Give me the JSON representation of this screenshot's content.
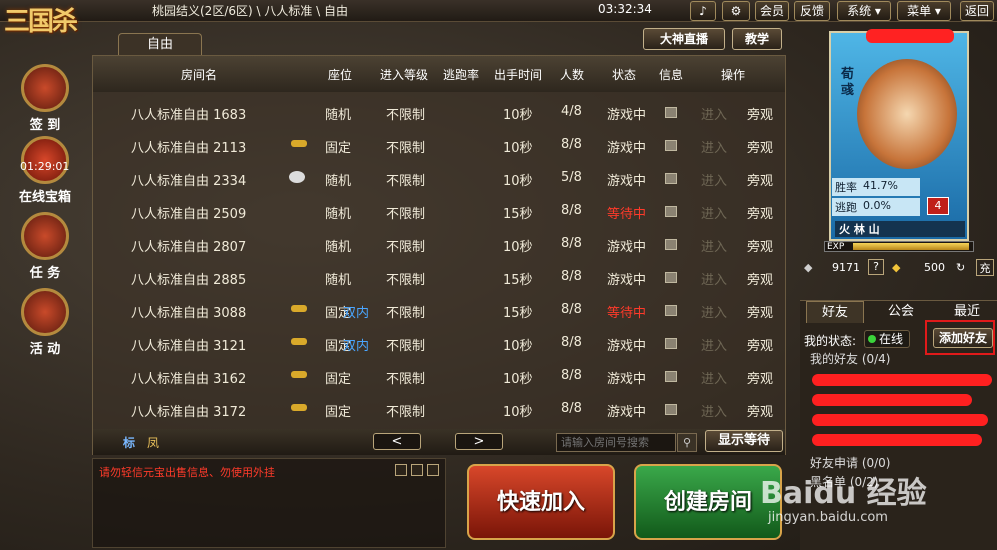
{
  "app": {
    "logo_text": "三国杀"
  },
  "topbar": {
    "breadcrumb": "桃园结义(2区/6区)  \\  八人标准  \\  自由",
    "clock": "03:32:34",
    "buttons": [
      "会员",
      "反馈",
      "系统 ▾",
      "菜单 ▾",
      "返回"
    ]
  },
  "left_menu": [
    {
      "label": "签 到"
    },
    {
      "label": "在线宝箱",
      "timer": "01:29:01"
    },
    {
      "label": "任 务"
    },
    {
      "label": "活 动"
    }
  ],
  "room_tab": "自由",
  "header_buttons": [
    "大神直播",
    "教学"
  ],
  "columns": [
    "房间名",
    "座位",
    "进入等级",
    "逃跑率",
    "出手时间",
    "人数",
    "状态",
    "信息",
    "操作"
  ],
  "rooms": [
    {
      "name": "八人标准自由  1683",
      "icon": "",
      "seat": "随机",
      "dual": "",
      "level": "不限制",
      "time": "10秒",
      "count": "4/8",
      "status": "游戏中",
      "waiting": false,
      "join": "进入",
      "watch": "旁观"
    },
    {
      "name": "八人标准自由  2113",
      "icon": "key-icon",
      "seat": "固定",
      "dual": "",
      "level": "不限制",
      "time": "10秒",
      "count": "8/8",
      "status": "游戏中",
      "waiting": false,
      "join": "进入",
      "watch": "旁观"
    },
    {
      "name": "八人标准自由  2334",
      "icon": "no-chat-icon",
      "seat": "随机",
      "dual": "",
      "level": "不限制",
      "time": "10秒",
      "count": "5/8",
      "status": "游戏中",
      "waiting": false,
      "join": "进入",
      "watch": "旁观"
    },
    {
      "name": "八人标准自由  2509",
      "icon": "",
      "seat": "随机",
      "dual": "",
      "level": "不限制",
      "time": "15秒",
      "count": "8/8",
      "status": "等待中",
      "waiting": true,
      "join": "进入",
      "watch": "旁观"
    },
    {
      "name": "八人标准自由  2807",
      "icon": "",
      "seat": "随机",
      "dual": "",
      "level": "不限制",
      "time": "10秒",
      "count": "8/8",
      "status": "游戏中",
      "waiting": false,
      "join": "进入",
      "watch": "旁观"
    },
    {
      "name": "八人标准自由  2885",
      "icon": "",
      "seat": "随机",
      "dual": "",
      "level": "不限制",
      "time": "15秒",
      "count": "8/8",
      "status": "游戏中",
      "waiting": false,
      "join": "进入",
      "watch": "旁观"
    },
    {
      "name": "八人标准自由  3088",
      "icon": "key-icon",
      "seat": "固定",
      "dual": "双内",
      "level": "不限制",
      "time": "15秒",
      "count": "8/8",
      "status": "等待中",
      "waiting": true,
      "join": "进入",
      "watch": "旁观"
    },
    {
      "name": "八人标准自由  3121",
      "icon": "key-icon",
      "seat": "固定",
      "dual": "双内",
      "level": "不限制",
      "time": "10秒",
      "count": "8/8",
      "status": "游戏中",
      "waiting": false,
      "join": "进入",
      "watch": "旁观"
    },
    {
      "name": "八人标准自由  3162",
      "icon": "key-icon",
      "seat": "固定",
      "dual": "",
      "level": "不限制",
      "time": "10秒",
      "count": "8/8",
      "status": "游戏中",
      "waiting": false,
      "join": "进入",
      "watch": "旁观"
    },
    {
      "name": "八人标准自由  3172",
      "icon": "key-icon",
      "seat": "固定",
      "dual": "",
      "level": "不限制",
      "time": "10秒",
      "count": "8/8",
      "status": "游戏中",
      "waiting": false,
      "join": "进入",
      "watch": "旁观"
    }
  ],
  "footer": {
    "legend1": "标",
    "legend2": "凤",
    "prev": "<",
    "next": ">",
    "search_placeholder": "请输入房间号搜索",
    "show_waiting": "显示等待"
  },
  "chat": {
    "warning": "请勿轻信元宝出售信息、勿使用外挂"
  },
  "actions": {
    "quick_join": "快速加入",
    "create_room": "创建房间"
  },
  "profile": {
    "general_name": "荀彧",
    "win_label": "胜率",
    "win_value": "41.7%",
    "escape_label": "逃跑",
    "escape_value": "0.0%",
    "level_badge": "4",
    "tags": "火 林 山 ",
    "exp_label": "EXP",
    "coins": "9171",
    "ingots": "500",
    "recharge": "充"
  },
  "friends": {
    "tabs": [
      "好友",
      "公会",
      "最近"
    ],
    "status_label": "我的状态:",
    "status_value": "在线",
    "add_friend": "添加好友",
    "my_friends": "我的好友  (0/4)",
    "requests": "好友申请  (0/0)",
    "blacklist": "黑名单  (0/2)"
  },
  "watermark": {
    "brand": "Baidu 经验",
    "url": "jingyan.baidu.com"
  }
}
